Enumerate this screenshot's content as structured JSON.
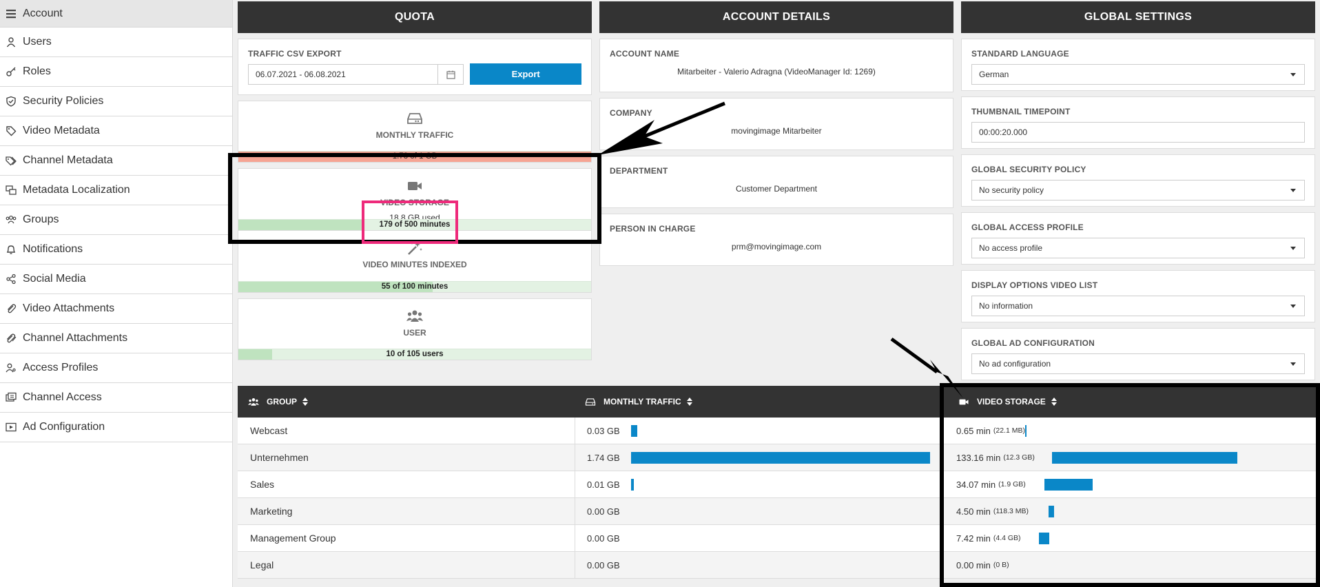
{
  "sidebar": {
    "items": [
      {
        "label": "Account",
        "icon": "account-icon",
        "active": true
      },
      {
        "label": "Users",
        "icon": "user-icon"
      },
      {
        "label": "Roles",
        "icon": "key-icon"
      },
      {
        "label": "Security Policies",
        "icon": "shield-icon"
      },
      {
        "label": "Video Metadata",
        "icon": "tag-icon"
      },
      {
        "label": "Channel Metadata",
        "icon": "tags-icon"
      },
      {
        "label": "Metadata Localization",
        "icon": "localization-icon"
      },
      {
        "label": "Groups",
        "icon": "group-icon"
      },
      {
        "label": "Notifications",
        "icon": "bell-icon"
      },
      {
        "label": "Social Media",
        "icon": "share-icon"
      },
      {
        "label": "Video Attachments",
        "icon": "paperclip-icon"
      },
      {
        "label": "Channel Attachments",
        "icon": "paperclips-icon"
      },
      {
        "label": "Access Profiles",
        "icon": "user-key-icon"
      },
      {
        "label": "Channel Access",
        "icon": "channel-access-icon"
      },
      {
        "label": "Ad Configuration",
        "icon": "ad-icon"
      }
    ]
  },
  "quota": {
    "title": "QUOTA",
    "csv_export": {
      "label": "TRAFFIC CSV EXPORT",
      "date_range": "06.07.2021 - 06.08.2021",
      "button": "Export"
    },
    "monthly_traffic": {
      "title": "MONTHLY TRAFFIC",
      "bar_text": "1.78 of 1 GB",
      "fill": 1.0
    },
    "video_storage": {
      "title": "VIDEO STORAGE",
      "used": "18.8 GB used",
      "bar_text": "179 of 500 minutes",
      "fill": 0.358
    },
    "video_minutes_indexed": {
      "title": "VIDEO MINUTES INDEXED",
      "bar_text": "55 of 100 minutes",
      "fill": 0.55
    },
    "user": {
      "title": "USER",
      "bar_text": "10 of 105 users",
      "fill": 0.095
    }
  },
  "account_details": {
    "title": "ACCOUNT DETAILS",
    "account_name": {
      "label": "ACCOUNT NAME",
      "value": "Mitarbeiter - Valerio Adragna (VideoManager Id: 1269)"
    },
    "company": {
      "label": "COMPANY",
      "value": "movingimage Mitarbeiter"
    },
    "department": {
      "label": "DEPARTMENT",
      "value": "Customer Department"
    },
    "person_in_charge": {
      "label": "PERSON IN CHARGE",
      "value": "prm@movingimage.com"
    }
  },
  "global_settings": {
    "title": "GLOBAL SETTINGS",
    "standard_language": {
      "label": "STANDARD LANGUAGE",
      "value": "German"
    },
    "thumbnail_timepoint": {
      "label": "THUMBNAIL TIMEPOINT",
      "value": "00:00:20.000"
    },
    "global_security_policy": {
      "label": "GLOBAL SECURITY POLICY",
      "value": "No security policy"
    },
    "global_access_profile": {
      "label": "GLOBAL ACCESS PROFILE",
      "value": "No access profile"
    },
    "display_options": {
      "label": "DISPLAY OPTIONS VIDEO LIST",
      "value": "No information"
    },
    "global_ad_configuration": {
      "label": "GLOBAL AD CONFIGURATION",
      "value": "No ad configuration"
    }
  },
  "groups_table": {
    "headers": {
      "group": "GROUP",
      "traffic": "MONTHLY TRAFFIC",
      "storage": "VIDEO STORAGE"
    },
    "rows": [
      {
        "group": "Webcast",
        "traffic": "0.03 GB",
        "traffic_frac": 0.02,
        "storage": "0.65 min",
        "storage_size": "(22.1 MB)",
        "storage_frac": 0.005
      },
      {
        "group": "Unternehmen",
        "traffic": "1.74 GB",
        "traffic_frac": 1.0,
        "storage": "133.16 min",
        "storage_size": "(12.3 GB)",
        "storage_frac": 1.0
      },
      {
        "group": "Sales",
        "traffic": "0.01 GB",
        "traffic_frac": 0.005,
        "storage": "34.07 min",
        "storage_size": "(1.9 GB)",
        "storage_frac": 0.26
      },
      {
        "group": "Marketing",
        "traffic": "0.00 GB",
        "traffic_frac": 0,
        "storage": "4.50 min",
        "storage_size": "(118.3 MB)",
        "storage_frac": 0.03
      },
      {
        "group": "Management Group",
        "traffic": "0.00 GB",
        "traffic_frac": 0,
        "storage": "7.42 min",
        "storage_size": "(4.4 GB)",
        "storage_frac": 0.055
      },
      {
        "group": "Legal",
        "traffic": "0.00 GB",
        "traffic_frac": 0,
        "storage": "0.00 min",
        "storage_size": "(0 B)",
        "storage_frac": 0
      }
    ]
  },
  "colors": {
    "accent": "#0a87c8",
    "header": "#333333",
    "traffic_over": "#f6a493",
    "quota_fill": "#bfe3bf",
    "annotation_pink": "#ee2a7b"
  }
}
